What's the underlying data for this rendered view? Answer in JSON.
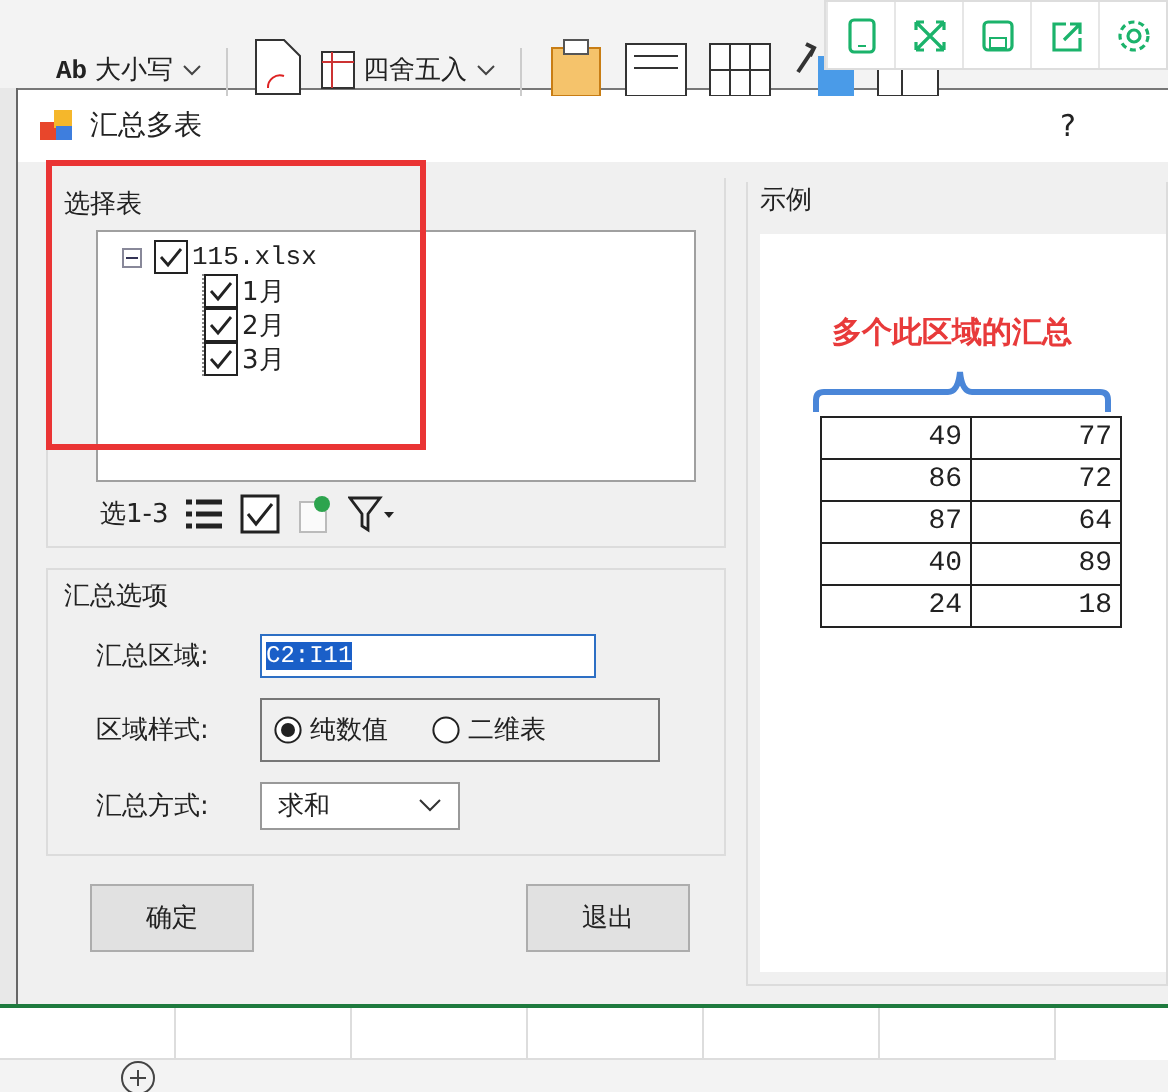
{
  "ribbon": {
    "case_button": {
      "icon_text": "Ab",
      "label": "大小写"
    },
    "round_button": {
      "label": "四舍五入"
    }
  },
  "dialog": {
    "title": "汇总多表",
    "help": "?",
    "select_group": {
      "title": "选择表",
      "tree": [
        {
          "label": "115.xlsx",
          "checked": true,
          "expanded": true,
          "children": [
            {
              "label": "1月",
              "checked": true
            },
            {
              "label": "2月",
              "checked": true
            },
            {
              "label": "3月",
              "checked": true
            }
          ]
        }
      ],
      "range_label": "选1-3"
    },
    "options_group": {
      "title": "汇总选项",
      "range": {
        "label": "汇总区域:",
        "value": "C2:I11"
      },
      "style": {
        "label": "区域样式:",
        "options": [
          {
            "label": "纯数值",
            "selected": true
          },
          {
            "label": "二维表",
            "selected": false
          }
        ]
      },
      "method": {
        "label": "汇总方式:",
        "value": "求和"
      }
    },
    "buttons": [
      {
        "label": "确定"
      },
      {
        "label": "退出"
      }
    ],
    "example_group": {
      "title": "示例",
      "caption": "多个此区域的汇总",
      "rows": [
        [
          "49",
          "77"
        ],
        [
          "86",
          "72"
        ],
        [
          "87",
          "64"
        ],
        [
          "40",
          "89"
        ],
        [
          "24",
          "18"
        ]
      ]
    }
  }
}
